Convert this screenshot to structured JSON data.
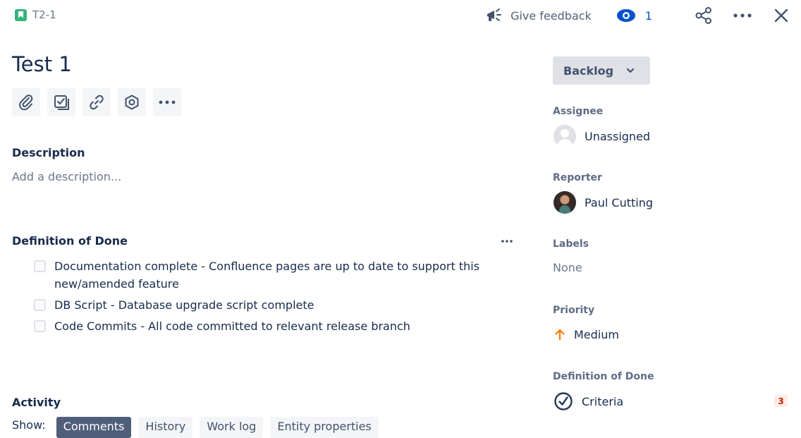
{
  "header": {
    "issue_key": "T2-1",
    "feedback_label": "Give feedback",
    "watch_count": "1"
  },
  "issue": {
    "title": "Test 1"
  },
  "description": {
    "heading": "Description",
    "placeholder": "Add a description..."
  },
  "definition_of_done": {
    "heading": "Definition of Done",
    "items": [
      {
        "text": "Documentation complete - Confluence pages are up to date to support this new/amended feature",
        "checked": false
      },
      {
        "text": "DB Script - Database upgrade script complete",
        "checked": false
      },
      {
        "text": "Code Commits - All code committed to relevant release branch",
        "checked": false
      }
    ]
  },
  "activity": {
    "heading": "Activity",
    "show_label": "Show:",
    "tabs": [
      "Comments",
      "History",
      "Work log",
      "Entity properties"
    ],
    "active_tab": "Comments"
  },
  "sidebar": {
    "status": "Backlog",
    "assignee_label": "Assignee",
    "assignee_value": "Unassigned",
    "reporter_label": "Reporter",
    "reporter_value": "Paul Cutting",
    "labels_label": "Labels",
    "labels_value": "None",
    "priority_label": "Priority",
    "priority_value": "Medium",
    "dod_label": "Definition of Done",
    "dod_value": "Criteria",
    "dod_count": "3"
  },
  "colors": {
    "story_green": "#36b37e",
    "watch_blue": "#0052cc",
    "priority_orange": "#ff7a00",
    "active_tab": "#505f79",
    "badge_red": "#bf2600"
  }
}
